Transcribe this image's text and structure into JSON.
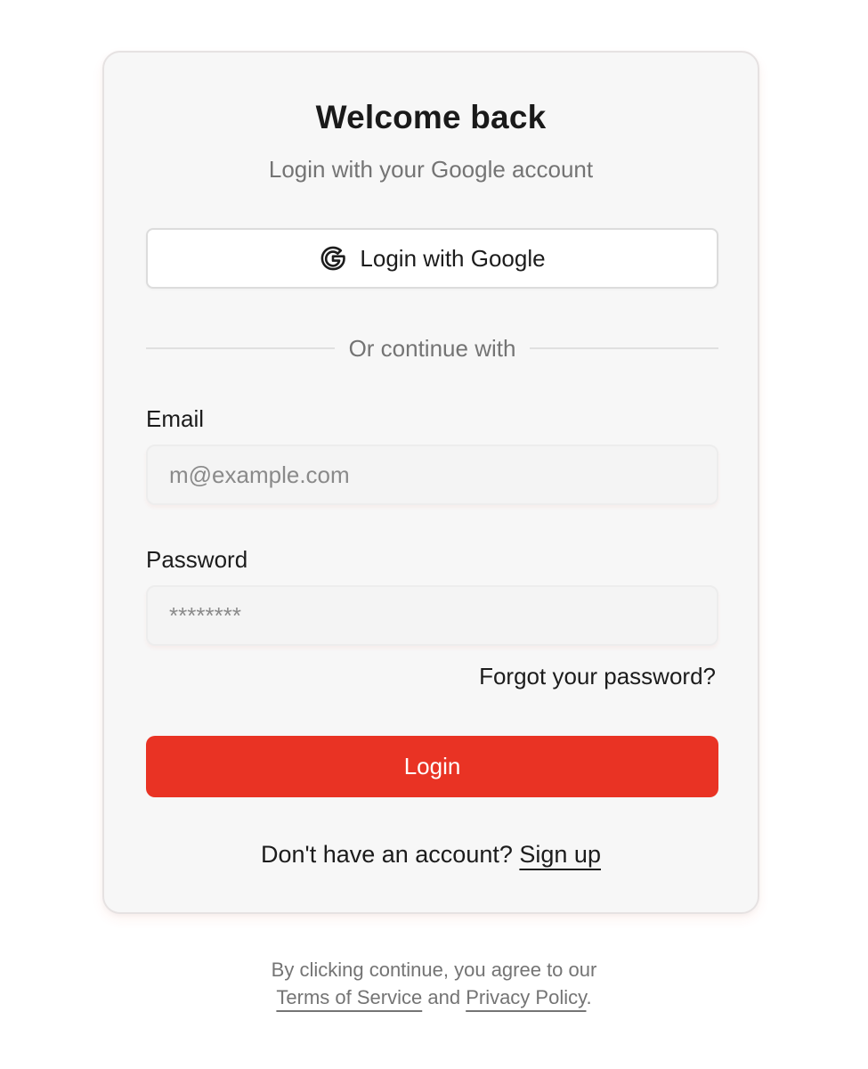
{
  "card": {
    "title": "Welcome back",
    "subtitle": "Login with your Google account"
  },
  "google_button": {
    "icon": "google-g-icon",
    "label": "Login with Google"
  },
  "divider": {
    "text": "Or continue with"
  },
  "email": {
    "label": "Email",
    "placeholder": "m@example.com",
    "value": ""
  },
  "password": {
    "label": "Password",
    "placeholder": "********",
    "value": ""
  },
  "forgot_password": "Forgot your password?",
  "login_button": "Login",
  "signup": {
    "prompt": "Don't have an account?",
    "link": "Sign up"
  },
  "legal": {
    "line1": "By clicking continue, you agree to our",
    "terms_link": "Terms of Service",
    "and_text": "and",
    "privacy_link": "Privacy Policy",
    "period": "."
  },
  "colors": {
    "accent": "#e93324",
    "card_background": "#f7f7f7",
    "muted_text": "#747474"
  }
}
